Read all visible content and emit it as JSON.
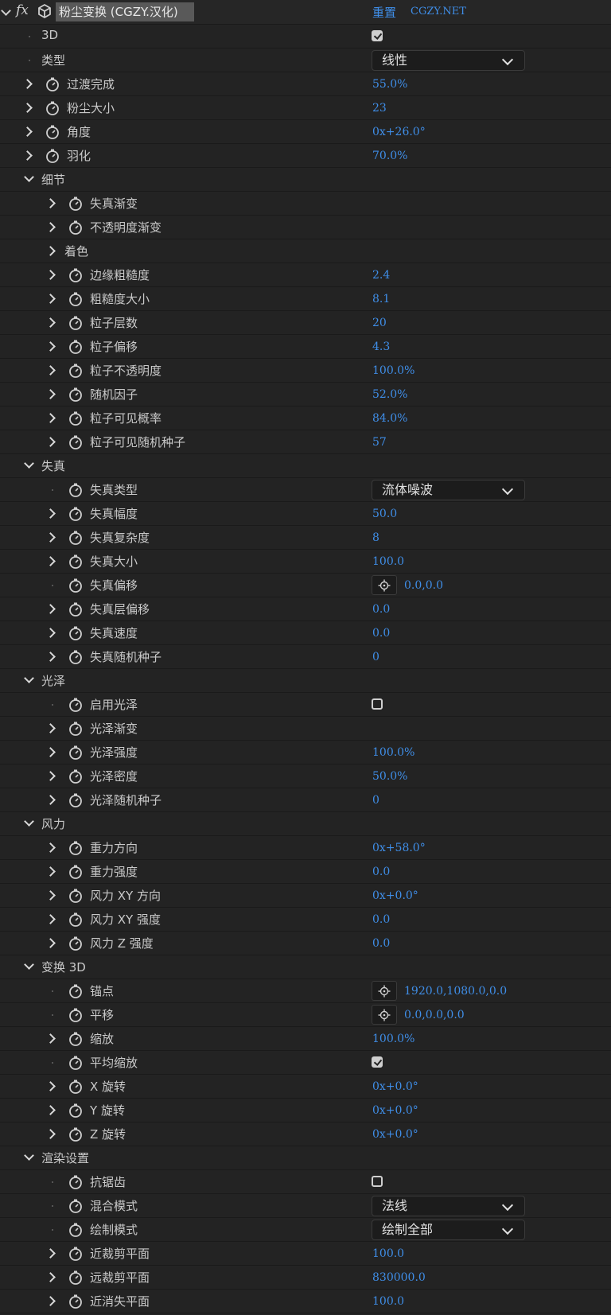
{
  "effect": {
    "name": "粉尘变换 (CGZY.汉化)",
    "reset_label": "重置",
    "about_label": "CGZY.NET"
  },
  "colors": {
    "background": "#232323",
    "value": "#3f8ee8",
    "label": "#c9c9c9",
    "name_bar": "#595959"
  },
  "rows": [
    {
      "label": "3D",
      "indent": 0,
      "twirl": "none",
      "stopwatch": false,
      "control": "checkbox",
      "checked": true
    },
    {
      "label": "类型",
      "indent": 0,
      "twirl": "none",
      "stopwatch": false,
      "control": "dropdown",
      "value": "线性"
    },
    {
      "label": "过渡完成",
      "indent": 0,
      "twirl": "closed",
      "stopwatch": true,
      "control": "value",
      "value": "55.0%"
    },
    {
      "label": "粉尘大小",
      "indent": 0,
      "twirl": "closed",
      "stopwatch": true,
      "control": "value",
      "value": "23"
    },
    {
      "label": "角度",
      "indent": 0,
      "twirl": "closed",
      "stopwatch": true,
      "control": "value",
      "value": "0x+26.0°"
    },
    {
      "label": "羽化",
      "indent": 0,
      "twirl": "closed",
      "stopwatch": true,
      "control": "value",
      "value": "70.0%"
    },
    {
      "label": "细节",
      "indent": 0,
      "twirl": "open",
      "stopwatch": false,
      "control": "none"
    },
    {
      "label": "失真渐变",
      "indent": 1,
      "twirl": "closed",
      "stopwatch": true,
      "control": "none"
    },
    {
      "label": "不透明度渐变",
      "indent": 1,
      "twirl": "closed",
      "stopwatch": true,
      "control": "none"
    },
    {
      "label": "着色",
      "indent": 1,
      "twirl": "closed",
      "stopwatch": false,
      "control": "none"
    },
    {
      "label": "边缘粗糙度",
      "indent": 1,
      "twirl": "closed",
      "stopwatch": true,
      "control": "value",
      "value": "2.4"
    },
    {
      "label": "粗糙度大小",
      "indent": 1,
      "twirl": "closed",
      "stopwatch": true,
      "control": "value",
      "value": "8.1"
    },
    {
      "label": "粒子层数",
      "indent": 1,
      "twirl": "closed",
      "stopwatch": true,
      "control": "value",
      "value": "20"
    },
    {
      "label": "粒子偏移",
      "indent": 1,
      "twirl": "closed",
      "stopwatch": true,
      "control": "value",
      "value": "4.3"
    },
    {
      "label": "粒子不透明度",
      "indent": 1,
      "twirl": "closed",
      "stopwatch": true,
      "control": "value",
      "value": "100.0%"
    },
    {
      "label": "随机因子",
      "indent": 1,
      "twirl": "closed",
      "stopwatch": true,
      "control": "value",
      "value": "52.0%"
    },
    {
      "label": "粒子可见概率",
      "indent": 1,
      "twirl": "closed",
      "stopwatch": true,
      "control": "value",
      "value": "84.0%"
    },
    {
      "label": "粒子可见随机种子",
      "indent": 1,
      "twirl": "closed",
      "stopwatch": true,
      "control": "value",
      "value": "57"
    },
    {
      "label": "失真",
      "indent": 0,
      "twirl": "open",
      "stopwatch": false,
      "control": "none"
    },
    {
      "label": "失真类型",
      "indent": 1,
      "twirl": "none",
      "stopwatch": true,
      "control": "dropdown",
      "value": "流体噪波"
    },
    {
      "label": "失真幅度",
      "indent": 1,
      "twirl": "closed",
      "stopwatch": true,
      "control": "value",
      "value": "50.0"
    },
    {
      "label": "失真复杂度",
      "indent": 1,
      "twirl": "closed",
      "stopwatch": true,
      "control": "value",
      "value": "8"
    },
    {
      "label": "失真大小",
      "indent": 1,
      "twirl": "closed",
      "stopwatch": true,
      "control": "value",
      "value": "100.0"
    },
    {
      "label": "失真偏移",
      "indent": 1,
      "twirl": "none",
      "stopwatch": true,
      "control": "point",
      "value": "0.0,0.0"
    },
    {
      "label": "失真层偏移",
      "indent": 1,
      "twirl": "closed",
      "stopwatch": true,
      "control": "value",
      "value": "0.0"
    },
    {
      "label": "失真速度",
      "indent": 1,
      "twirl": "closed",
      "stopwatch": true,
      "control": "value",
      "value": "0.0"
    },
    {
      "label": "失真随机种子",
      "indent": 1,
      "twirl": "closed",
      "stopwatch": true,
      "control": "value",
      "value": "0"
    },
    {
      "label": "光泽",
      "indent": 0,
      "twirl": "open",
      "stopwatch": false,
      "control": "none"
    },
    {
      "label": "启用光泽",
      "indent": 1,
      "twirl": "none",
      "stopwatch": true,
      "control": "checkbox",
      "checked": false
    },
    {
      "label": "光泽渐变",
      "indent": 1,
      "twirl": "closed",
      "stopwatch": true,
      "control": "none"
    },
    {
      "label": "光泽强度",
      "indent": 1,
      "twirl": "closed",
      "stopwatch": true,
      "control": "value",
      "value": "100.0%"
    },
    {
      "label": "光泽密度",
      "indent": 1,
      "twirl": "closed",
      "stopwatch": true,
      "control": "value",
      "value": "50.0%"
    },
    {
      "label": "光泽随机种子",
      "indent": 1,
      "twirl": "closed",
      "stopwatch": true,
      "control": "value",
      "value": "0"
    },
    {
      "label": "风力",
      "indent": 0,
      "twirl": "open",
      "stopwatch": false,
      "control": "none"
    },
    {
      "label": "重力方向",
      "indent": 1,
      "twirl": "closed",
      "stopwatch": true,
      "control": "value",
      "value": "0x+58.0°"
    },
    {
      "label": "重力强度",
      "indent": 1,
      "twirl": "closed",
      "stopwatch": true,
      "control": "value",
      "value": "0.0"
    },
    {
      "label": "风力 XY 方向",
      "indent": 1,
      "twirl": "closed",
      "stopwatch": true,
      "control": "value",
      "value": "0x+0.0°"
    },
    {
      "label": "风力 XY 强度",
      "indent": 1,
      "twirl": "closed",
      "stopwatch": true,
      "control": "value",
      "value": "0.0"
    },
    {
      "label": "风力 Z 强度",
      "indent": 1,
      "twirl": "closed",
      "stopwatch": true,
      "control": "value",
      "value": "0.0"
    },
    {
      "label": "变换 3D",
      "indent": 0,
      "twirl": "open",
      "stopwatch": false,
      "control": "none"
    },
    {
      "label": "锚点",
      "indent": 1,
      "twirl": "none",
      "stopwatch": true,
      "control": "point",
      "value": "1920.0,1080.0,0.0"
    },
    {
      "label": "平移",
      "indent": 1,
      "twirl": "none",
      "stopwatch": true,
      "control": "point",
      "value": "0.0,0.0,0.0"
    },
    {
      "label": "缩放",
      "indent": 1,
      "twirl": "closed",
      "stopwatch": true,
      "control": "value",
      "value": "100.0%"
    },
    {
      "label": "平均缩放",
      "indent": 1,
      "twirl": "none",
      "stopwatch": true,
      "control": "checkbox",
      "checked": true
    },
    {
      "label": "X 旋转",
      "indent": 1,
      "twirl": "closed",
      "stopwatch": true,
      "control": "value",
      "value": "0x+0.0°"
    },
    {
      "label": "Y 旋转",
      "indent": 1,
      "twirl": "closed",
      "stopwatch": true,
      "control": "value",
      "value": "0x+0.0°"
    },
    {
      "label": "Z 旋转",
      "indent": 1,
      "twirl": "closed",
      "stopwatch": true,
      "control": "value",
      "value": "0x+0.0°"
    },
    {
      "label": "渲染设置",
      "indent": 0,
      "twirl": "open",
      "stopwatch": false,
      "control": "none"
    },
    {
      "label": "抗锯齿",
      "indent": 1,
      "twirl": "none",
      "stopwatch": true,
      "control": "checkbox",
      "checked": false
    },
    {
      "label": "混合模式",
      "indent": 1,
      "twirl": "none",
      "stopwatch": true,
      "control": "dropdown",
      "value": "法线"
    },
    {
      "label": "绘制模式",
      "indent": 1,
      "twirl": "none",
      "stopwatch": true,
      "control": "dropdown",
      "value": "绘制全部"
    },
    {
      "label": "近裁剪平面",
      "indent": 1,
      "twirl": "closed",
      "stopwatch": true,
      "control": "value",
      "value": "100.0"
    },
    {
      "label": "远裁剪平面",
      "indent": 1,
      "twirl": "closed",
      "stopwatch": true,
      "control": "value",
      "value": "830000.0"
    },
    {
      "label": "近消失平面",
      "indent": 1,
      "twirl": "closed",
      "stopwatch": true,
      "control": "value",
      "value": "100.0"
    }
  ]
}
